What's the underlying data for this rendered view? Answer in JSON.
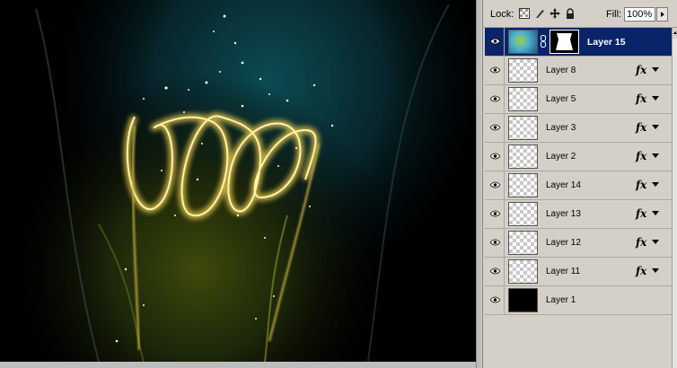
{
  "canvas": {
    "description_icon": "glowing-spiral-light-painting"
  },
  "layers_panel": {
    "lock_label": "Lock:",
    "lock_icons": [
      "lock-transparent-pixels-icon",
      "lock-image-pixels-icon",
      "lock-position-icon",
      "lock-all-icon"
    ],
    "fill_label": "Fill:",
    "fill_value": "100%",
    "layers": [
      {
        "name": "Layer 15",
        "selected": true,
        "fx": false,
        "thumb": "color",
        "has_mask": true
      },
      {
        "name": "Layer 8",
        "selected": false,
        "fx": true,
        "thumb": "transparent"
      },
      {
        "name": "Layer 5",
        "selected": false,
        "fx": true,
        "thumb": "transparent"
      },
      {
        "name": "Layer 3",
        "selected": false,
        "fx": true,
        "thumb": "transparent"
      },
      {
        "name": "Layer 2",
        "selected": false,
        "fx": true,
        "thumb": "transparent"
      },
      {
        "name": "Layer 14",
        "selected": false,
        "fx": true,
        "thumb": "transparent"
      },
      {
        "name": "Layer 13",
        "selected": false,
        "fx": true,
        "thumb": "transparent"
      },
      {
        "name": "Layer 12",
        "selected": false,
        "fx": true,
        "thumb": "transparent"
      },
      {
        "name": "Layer 11",
        "selected": false,
        "fx": true,
        "thumb": "transparent"
      },
      {
        "name": "Layer 1",
        "selected": false,
        "fx": false,
        "thumb": "black"
      }
    ],
    "fx_symbol": "fx",
    "colors": {
      "selected_row": "#0a246a",
      "panel_bg": "#d4d0c8"
    }
  }
}
